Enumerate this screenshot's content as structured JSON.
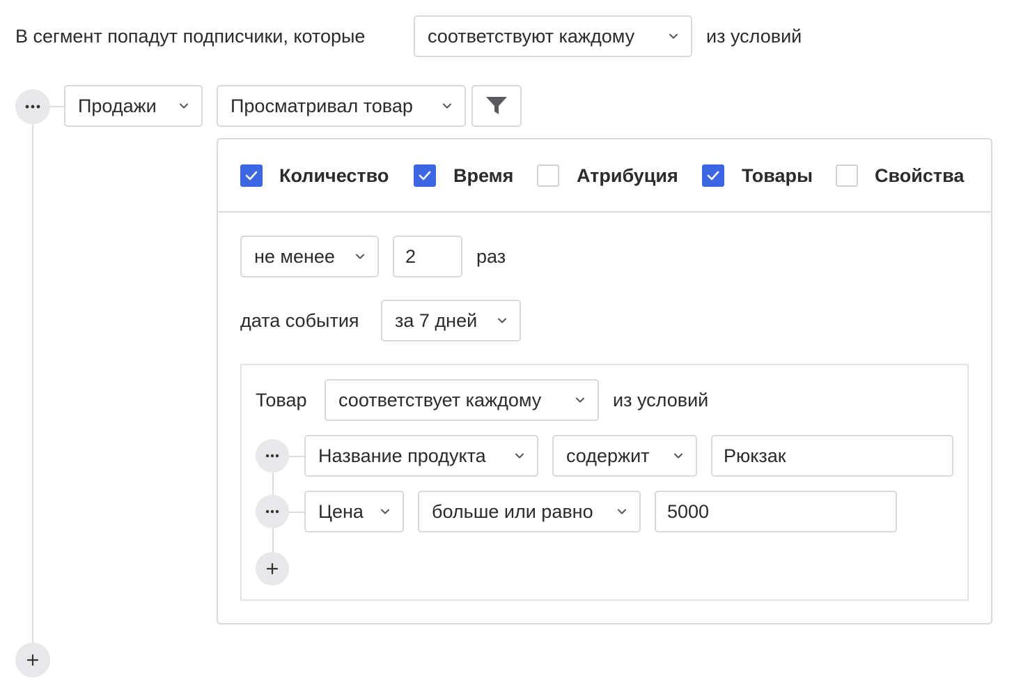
{
  "header": {
    "prefix": "В сегмент попадут подписчики, которые",
    "match_value": "соответствуют каждому",
    "suffix": "из условий"
  },
  "rule": {
    "category_value": "Продажи",
    "event_value": "Просматривал товар",
    "filter_icon": "funnel-icon",
    "more_icon": "ellipsis-icon"
  },
  "options": [
    {
      "label": "Количество",
      "checked": true
    },
    {
      "label": "Время",
      "checked": true
    },
    {
      "label": "Атрибуция",
      "checked": false
    },
    {
      "label": "Товары",
      "checked": true
    },
    {
      "label": "Свойства",
      "checked": false
    }
  ],
  "quantity": {
    "operator_value": "не менее",
    "count_value": "2",
    "unit": "раз"
  },
  "time": {
    "label": "дата события",
    "period_value": "за 7 дней"
  },
  "product": {
    "label": "Товар",
    "match_value": "соответствует каждому",
    "suffix": "из условий",
    "conditions": [
      {
        "field": "Название продукта",
        "operator": "содержит",
        "value": "Рюкзак"
      },
      {
        "field": "Цена",
        "operator": "больше или равно",
        "value": "5000"
      }
    ],
    "add_icon": "plus-icon"
  },
  "add_rule_icon": "plus-icon",
  "colors": {
    "accent": "#3d66e3",
    "border": "#d9d9dc",
    "circle_bg": "#e8e8eb"
  }
}
